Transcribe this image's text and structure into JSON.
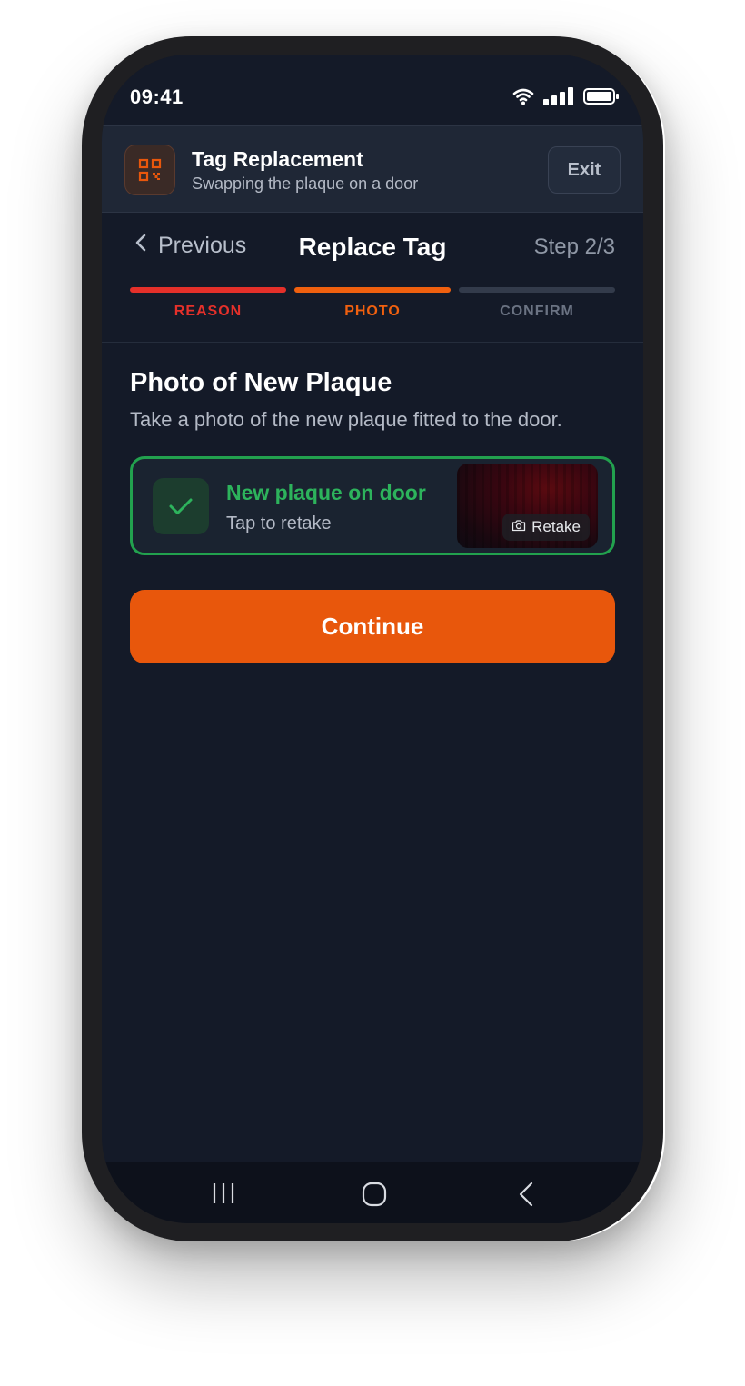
{
  "status_bar": {
    "time": "09:41"
  },
  "app_header": {
    "title": "Tag Replacement",
    "subtitle": "Swapping the plaque on a door",
    "exit_label": "Exit",
    "icon": "qr-code-icon"
  },
  "nav": {
    "previous_label": "Previous",
    "title": "Replace Tag",
    "step": "Step 2/3"
  },
  "progress_steps": [
    {
      "label": "REASON",
      "color": "#e5302a",
      "state": "done"
    },
    {
      "label": "PHOTO",
      "color": "#f0600f",
      "state": "current"
    },
    {
      "label": "CONFIRM",
      "color": "#333b4b",
      "state": "pending",
      "label_color": "#6b7383"
    }
  ],
  "section": {
    "title": "Photo of New Plaque",
    "description": "Take a photo of the new plaque fitted to the door."
  },
  "photo_card": {
    "title": "New plaque on door",
    "subtitle": "Tap to retake",
    "retake_label": "Retake",
    "status_color": "#22a14e"
  },
  "continue_label": "Continue",
  "colors": {
    "background": "#141a28",
    "accent": "#e8570c",
    "success": "#22a14e"
  }
}
